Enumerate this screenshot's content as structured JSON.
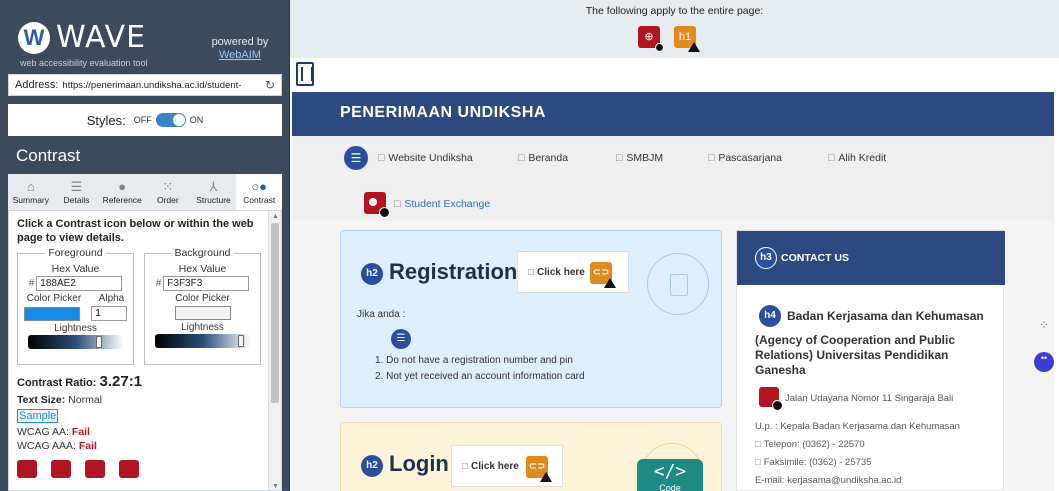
{
  "wave": {
    "logo_letter": "W",
    "brand": "WAVE",
    "tagline": "web accessibility evaluation tool",
    "powered_by": "powered by",
    "powered_link": "WebAIM",
    "address_label": "Address:",
    "address_value": "https://penerimaan.undiksha.ac.id/student-",
    "styles_label": "Styles:",
    "styles_off": "OFF",
    "styles_on": "ON",
    "panel_title": "Contrast",
    "tabs": [
      {
        "label": "Summary",
        "icon": "home-icon"
      },
      {
        "label": "Details",
        "icon": "list-icon"
      },
      {
        "label": "Reference",
        "icon": "info-icon"
      },
      {
        "label": "Order",
        "icon": "order-icon"
      },
      {
        "label": "Structure",
        "icon": "structure-icon"
      },
      {
        "label": "Contrast",
        "icon": "contrast-icon"
      }
    ],
    "instructions": "Click a Contrast icon below or within the web page to view details.",
    "foreground": {
      "title": "Foreground",
      "hex_label": "Hex Value",
      "hex_value": "188AE2",
      "picker_label": "Color Picker",
      "alpha_label": "Alpha",
      "alpha_value": "1",
      "lightness_label": "Lightness",
      "color": "#188AE2",
      "lightness_level": 0.78
    },
    "background": {
      "title": "Background",
      "hex_label": "Hex Value",
      "hex_value": "F3F3F3",
      "picker_label": "Color Picker",
      "lightness_label": "Lightness",
      "color": "#F3F3F3",
      "lightness_level": 0.95
    },
    "contrast_label": "Contrast Ratio:",
    "contrast_value": "3.27:1",
    "text_size_label": "Text Size:",
    "text_size_value": "Normal",
    "sample": "Sample",
    "wcag_aa_label": "WCAG AA:",
    "wcag_aa_value": "Fail",
    "wcag_aaa_label": "WCAG AAA:",
    "wcag_aaa_value": "Fail"
  },
  "banner": {
    "text": "The following apply to the entire page:",
    "icon_lang": "language-error-icon",
    "icon_h1": "h1",
    "icon_h1_name": "missing-h1-alert-icon"
  },
  "site": {
    "title": "PENERIMAAN UNDIKSHA",
    "box_glyph": "□",
    "nav": [
      "Website Undiksha",
      "Beranda",
      "SMBJM",
      "Pascasarjana",
      "Alih Kredit"
    ],
    "nav_exchange": "Student Exchange",
    "registration": {
      "badge": "h2",
      "title": "Registration",
      "click_here": "Click here",
      "jika": "Jika anda :",
      "items": [
        "1. Do not have a registration number and pin",
        "2. Not yet received an account information card"
      ]
    },
    "login": {
      "badge": "h2",
      "title": "Login",
      "click_here": "Click here",
      "code_symbol": "</>",
      "code_label": "Code"
    },
    "contact": {
      "badge": "h3",
      "title": "CONTACT US",
      "h4_badge": "h4",
      "org_line1": "Badan Kerjasama dan Kehumasan",
      "org_line2": "(Agency of Cooperation and Public Relations) Universitas Pendidikan Ganesha",
      "address": "Jalan Udayana Nomor 11 Singaraja Bali",
      "up": "U.p. : Kepala Badan Kerjasama dan Kehumasan",
      "phone": "Telepon: (0362) - 22570",
      "fax": "Faksimile: (0362) - 25735",
      "email": "E-mail: kerjasama@undiksha.ac.id"
    }
  },
  "colors": {
    "sidebar_bg": "#3b4a5d",
    "site_blue": "#2d4a80",
    "error_red": "#b01622",
    "alert_orange": "#e08a1e",
    "fail_red": "#c3141a"
  }
}
